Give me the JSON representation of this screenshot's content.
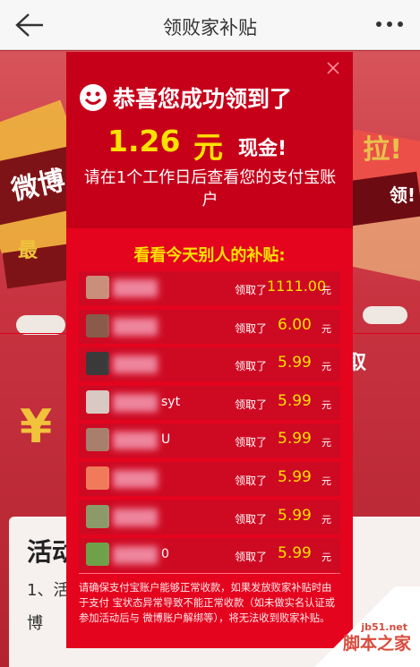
{
  "header": {
    "title": "领败家补贴",
    "back_icon": "arrow-left-icon",
    "more_icon": "more-dots-icon"
  },
  "background": {
    "text_left": "微博",
    "text_left2": "最",
    "text_right": "拉!",
    "text_right2": "领!",
    "text_right3": "取",
    "panel_title": "活动",
    "panel_line1": "1、活",
    "panel_line2": "博",
    "yen_symbol": "¥"
  },
  "modal": {
    "congrats": "恭喜您成功领到了",
    "amount": "1.26",
    "amount_unit": "元",
    "cash_label": "现金!",
    "notice": "请在1个工作日后查看您的支付宝账户",
    "list_title": "看看今天别人的补贴:",
    "claim_label": "领取了",
    "yuan": "元",
    "rows": [
      {
        "name": "",
        "value": "1111.00",
        "avatar_color": "#c98f7a"
      },
      {
        "name": "",
        "value": "6.00",
        "avatar_color": "#8a5a4a"
      },
      {
        "name": "",
        "value": "5.99",
        "avatar_color": "#3a3a3a"
      },
      {
        "name": "syt",
        "value": "5.99",
        "avatar_color": "#d8c9c2"
      },
      {
        "name": "U",
        "value": "5.99",
        "avatar_color": "#a87e6c"
      },
      {
        "name": "",
        "value": "5.99",
        "avatar_color": "#f07a5a"
      },
      {
        "name": "",
        "value": "5.99",
        "avatar_color": "#8c9a6a"
      },
      {
        "name": "0",
        "value": "5.99",
        "avatar_color": "#6fa04a"
      }
    ],
    "footnote": "请确保支付宝账户能够正常收款，如果发放败家补贴时由于支付 宝状态异常导致不能正常收款（如未做实名认证或参加活动后与 微博账户解绑等），将无法收到败家补贴。"
  },
  "watermark": {
    "url": "jb51.net",
    "text": "脚本之家"
  },
  "colors": {
    "modal_bg": "#e4041e",
    "modal_top": "#c7001a",
    "highlight": "#ffe100"
  }
}
